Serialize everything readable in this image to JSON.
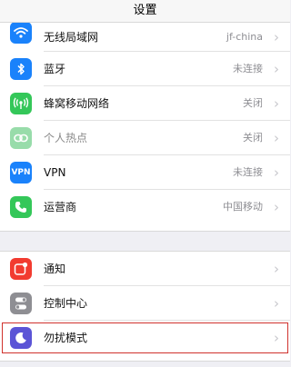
{
  "header": {
    "title": "设置"
  },
  "network": [
    {
      "label": "无线局域网",
      "value": "jf-china",
      "icon": "wifi-icon",
      "color": "#1a82fb"
    },
    {
      "label": "蓝牙",
      "value": "未连接",
      "icon": "bluetooth-icon",
      "color": "#1a82fb"
    },
    {
      "label": "蜂窝移动网络",
      "value": "关闭",
      "icon": "cellular-icon",
      "color": "#34c759"
    },
    {
      "label": "个人热点",
      "value": "关闭",
      "icon": "hotspot-icon",
      "color": "#98dcaa"
    },
    {
      "label": "VPN",
      "value": "未连接",
      "icon": "vpn-icon",
      "color": "#1a82fb"
    },
    {
      "label": "运营商",
      "value": "中国移动",
      "icon": "phone-icon",
      "color": "#34c759"
    }
  ],
  "system": [
    {
      "label": "通知",
      "icon": "notifications-icon",
      "color": "#f23b30"
    },
    {
      "label": "控制中心",
      "icon": "control-center-icon",
      "color": "#8e8e93"
    },
    {
      "label": "勿扰模式",
      "icon": "moon-icon",
      "color": "#5b54d6",
      "highlighted": true
    }
  ],
  "chevron": "›"
}
